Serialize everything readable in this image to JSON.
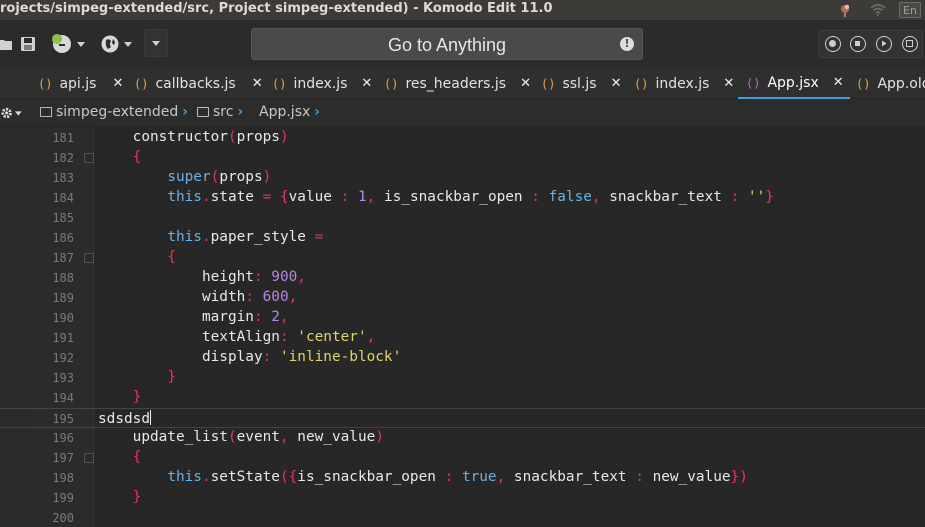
{
  "window": {
    "title": "rojects/simpeg-extended/src, Project simpeg-extended) - Komodo Edit 11.0",
    "lang_indicator": "En"
  },
  "toolbar": {
    "goto_label": "Go to Anything"
  },
  "tabs": [
    {
      "label": "api.js",
      "type": "js",
      "active": false
    },
    {
      "label": "callbacks.js",
      "type": "js",
      "active": false
    },
    {
      "label": "index.js",
      "type": "js",
      "active": false
    },
    {
      "label": "res_headers.js",
      "type": "js",
      "active": false
    },
    {
      "label": "ssl.js",
      "type": "js",
      "active": false
    },
    {
      "label": "index.js",
      "type": "js",
      "active": false
    },
    {
      "label": "App.jsx",
      "type": "jsx",
      "active": true
    },
    {
      "label": "App.old",
      "type": "js",
      "active": false
    }
  ],
  "breadcrumb": [
    {
      "label": "simpeg-extended",
      "folder": true
    },
    {
      "label": "src",
      "folder": true
    },
    {
      "label": "App.jsx",
      "folder": false
    }
  ],
  "editor": {
    "current_line": 195,
    "lines": [
      {
        "num": "181",
        "text": "    constructor(props)"
      },
      {
        "num": "182",
        "text": "    {"
      },
      {
        "num": "183",
        "text": "        super(props)"
      },
      {
        "num": "184",
        "text": "        this.state = {value : 1, is_snackbar_open : false, snackbar_text : ''}"
      },
      {
        "num": "185",
        "text": ""
      },
      {
        "num": "186",
        "text": "        this.paper_style ="
      },
      {
        "num": "187",
        "text": "        {"
      },
      {
        "num": "188",
        "text": "            height: 900,"
      },
      {
        "num": "189",
        "text": "            width: 600,"
      },
      {
        "num": "190",
        "text": "            margin: 2,"
      },
      {
        "num": "191",
        "text": "            textAlign: 'center',"
      },
      {
        "num": "192",
        "text": "            display: 'inline-block'"
      },
      {
        "num": "193",
        "text": "        }"
      },
      {
        "num": "194",
        "text": "    }"
      },
      {
        "num": "195",
        "text": "sdsdsd"
      },
      {
        "num": "196",
        "text": "    update_list(event, new_value)"
      },
      {
        "num": "197",
        "text": "    {"
      },
      {
        "num": "198",
        "text": "        this.setState({is_snackbar_open : true, snackbar_text : new_value})"
      },
      {
        "num": "199",
        "text": "    }"
      },
      {
        "num": "200",
        "text": ""
      }
    ]
  },
  "colors": {
    "accent": "#3aa0e0",
    "keyword": "#6ab1e6",
    "punct": "#e8345f",
    "number": "#b689e0",
    "string": "#e2d468"
  }
}
